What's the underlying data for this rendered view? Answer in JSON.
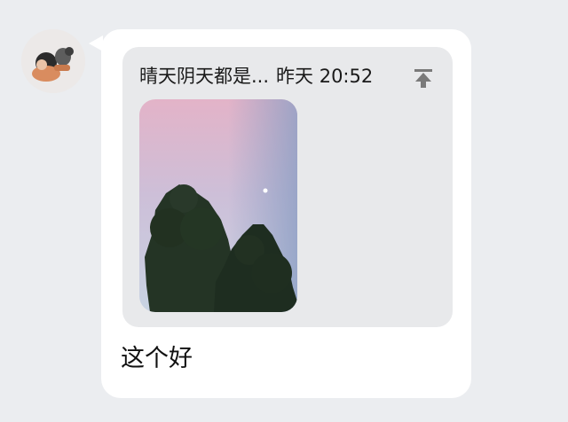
{
  "message": {
    "quote": {
      "sender": "晴天阴天都是...",
      "time": "昨天 20:52",
      "pin_icon": "pin-to-top-icon",
      "image_icon": "sky-trees-photo"
    },
    "text": "这个好"
  },
  "colors": {
    "background": "#ebedf0",
    "bubble": "#ffffff",
    "quote_background": "#e8e9eb",
    "text": "#111111",
    "icon": "#7a7a7a"
  }
}
